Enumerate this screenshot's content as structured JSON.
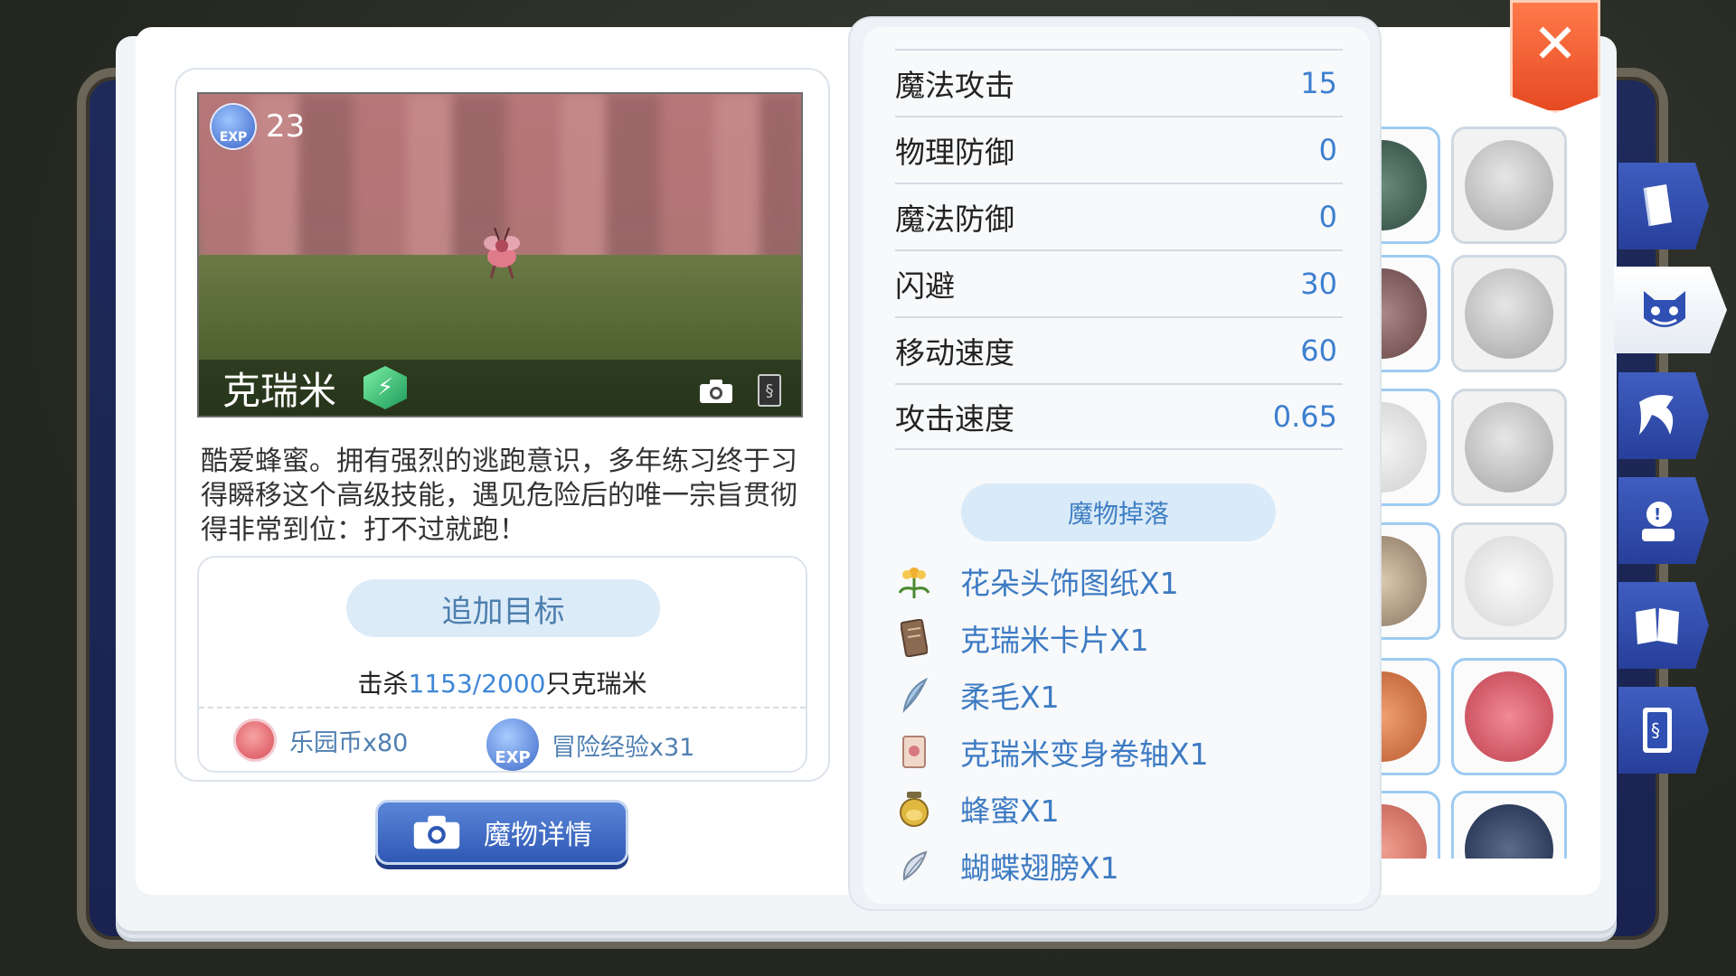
{
  "monster": {
    "exp": "23",
    "exp_icon_label": "EXP",
    "name": "克瑞米",
    "description": "酷爱蜂蜜。拥有强烈的逃跑意识，多年练习终于习得瞬移这个高级技能，遇见危险后的唯一宗旨贯彻得非常到位：打不过就跑！"
  },
  "target": {
    "add_label": "追加目标",
    "kill_prefix": "击杀",
    "kill_count": "1153/2000",
    "kill_suffix": "只克瑞米",
    "rewards": [
      {
        "icon": "park-coin-icon",
        "label": "乐园币x80"
      },
      {
        "icon": "exp-icon",
        "icon_label": "EXP",
        "label": "冒险经验x31"
      }
    ]
  },
  "detail_button": {
    "label": "魔物详情"
  },
  "stats": [
    {
      "label": "魔法攻击",
      "value": "15"
    },
    {
      "label": "物理防御",
      "value": "0"
    },
    {
      "label": "魔法防御",
      "value": "0"
    },
    {
      "label": "闪避",
      "value": "30"
    },
    {
      "label": "移动速度",
      "value": "60"
    },
    {
      "label": "攻击速度",
      "value": "0.65"
    }
  ],
  "drops": {
    "button_label": "魔物掉落",
    "items": [
      {
        "icon": "flower-icon",
        "label": "花朵头饰图纸X1"
      },
      {
        "icon": "card-icon",
        "label": "克瑞米卡片X1"
      },
      {
        "icon": "feather-icon",
        "label": "柔毛X1"
      },
      {
        "icon": "scroll-icon",
        "label": "克瑞米变身卷轴X1"
      },
      {
        "icon": "honey-jar-icon",
        "label": "蜂蜜X1"
      },
      {
        "icon": "wing-icon",
        "label": "蝴蝶翅膀X1"
      }
    ]
  },
  "side_tabs": [
    {
      "icon": "book-icon",
      "active": false
    },
    {
      "icon": "monster-face-icon",
      "active": true
    },
    {
      "icon": "horn-icon",
      "active": false
    },
    {
      "icon": "npc-head-icon",
      "active": false
    },
    {
      "icon": "open-book-icon",
      "active": false
    },
    {
      "icon": "card-icon",
      "active": false
    }
  ],
  "colors": {
    "accent_blue": "#3d7fd0",
    "close_orange": "#e64a22",
    "tab_blue": "#2f4fb2"
  }
}
